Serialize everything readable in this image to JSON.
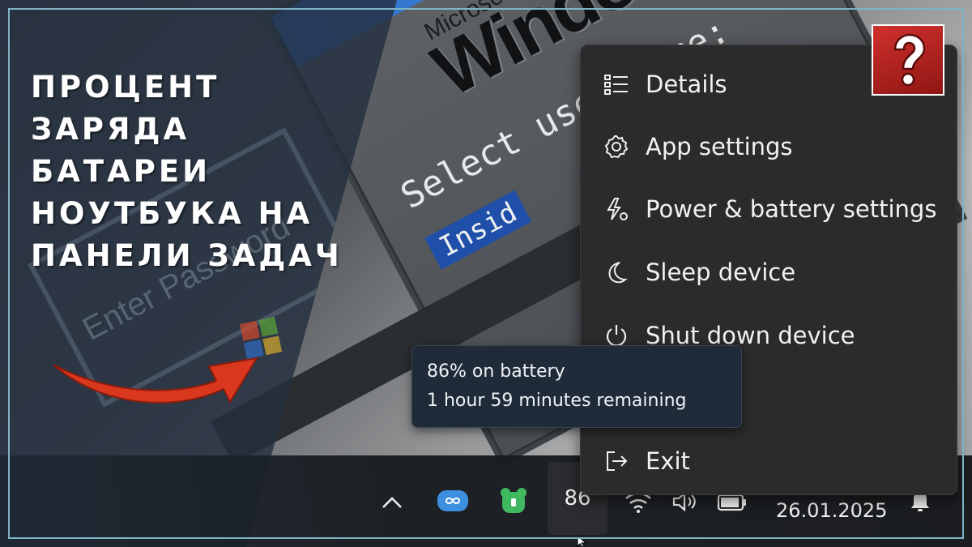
{
  "title": {
    "lines": [
      "ПРОЦЕНТ",
      "ЗАРЯДА",
      "БАТАРЕИ",
      "НОУТБУКА НА",
      "ПАНЕЛИ ЗАДАЧ"
    ]
  },
  "background": {
    "microsoft_text": "Microsoft",
    "windows_text": "Windows",
    "select_user_text": "Select user name:",
    "insider_text": "Insid",
    "ghost_text": "Enter Password"
  },
  "help_badge": {
    "icon": "question-mark-icon"
  },
  "context_menu": {
    "items": [
      {
        "label": "Details",
        "icon": "details-list-icon"
      },
      {
        "label": "App settings",
        "icon": "gear-icon"
      },
      {
        "label": "Power & battery settings",
        "icon": "battery-settings-icon"
      },
      {
        "label": "Sleep device",
        "icon": "moon-icon"
      },
      {
        "label": "Shut down device",
        "icon": "power-icon"
      },
      {
        "label": "Exit",
        "icon": "exit-icon"
      }
    ]
  },
  "tooltip": {
    "line1": "86% on battery",
    "line2": "1 hour 59 minutes remaining"
  },
  "taskbar": {
    "battery_percent": "86",
    "date": "26.01.2025",
    "icons": [
      "chevron-up-icon",
      "infinity-app-icon",
      "green-bear-app-icon",
      "wifi-icon",
      "volume-icon",
      "battery-icon",
      "notification-bell-icon"
    ]
  },
  "colors": {
    "menu_bg": "#2b2b2b",
    "tooltip_bg": "#1f2b38",
    "frame": "#7fb3c4",
    "badge": "#c62a27",
    "arrow": "#d9381e"
  }
}
